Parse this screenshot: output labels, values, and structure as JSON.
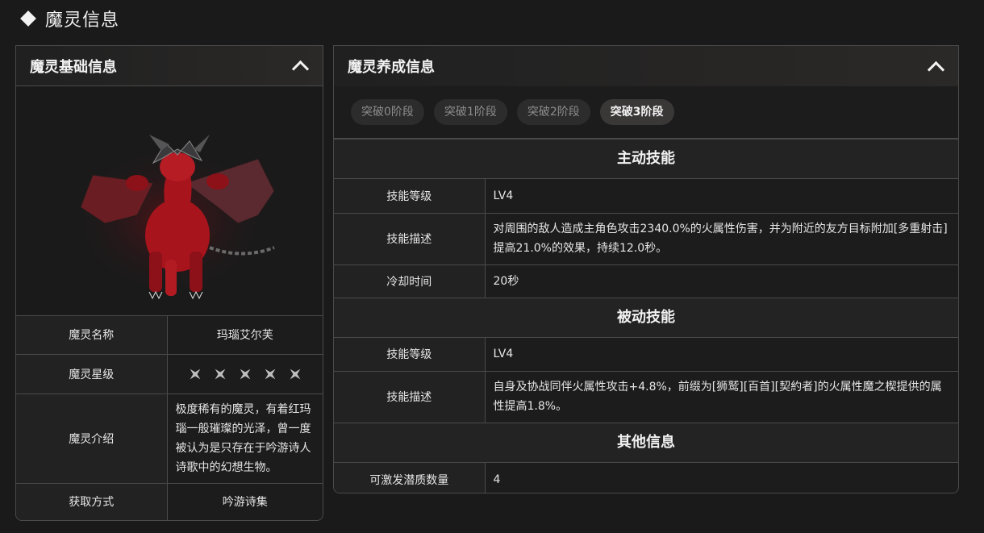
{
  "page": {
    "title": "魔灵信息"
  },
  "basic": {
    "title": "魔灵基础信息",
    "rows": {
      "name_label": "魔灵名称",
      "name_value": "玛瑙艾尔芙",
      "star_label": "魔灵星级",
      "star_count": 5,
      "intro_label": "魔灵介绍",
      "intro_value": "极度稀有的魔灵，有着红玛瑙一般璀璨的光泽，曾一度被认为是只存在于吟游诗人诗歌中的幻想生物。",
      "source_label": "获取方式",
      "source_value": "吟游诗集"
    }
  },
  "growth": {
    "title": "魔灵养成信息",
    "tabs": [
      "突破0阶段",
      "突破1阶段",
      "突破2阶段",
      "突破3阶段"
    ],
    "active_tab": 3,
    "active_skill": {
      "title": "主动技能",
      "level_label": "技能等级",
      "level_value": "LV4",
      "desc_label": "技能描述",
      "desc_value": "对周围的敌人造成主角色攻击2340.0%的火属性伤害，并为附近的友方目标附加[多重射击]提高21.0%的效果，持续12.0秒。",
      "cd_label": "冷却时间",
      "cd_value": "20秒"
    },
    "passive_skill": {
      "title": "被动技能",
      "level_label": "技能等级",
      "level_value": "LV4",
      "desc_label": "技能描述",
      "desc_value": "自身及协战同伴火属性攻击+4.8%，前缀为[狮鹫][百首][契約者]的火属性魔之楔提供的属性提高1.8%。"
    },
    "other": {
      "title": "其他信息",
      "potential_label": "可激发潜质数量",
      "potential_value": "4"
    }
  },
  "colors": {
    "accent_red": "#a8141c",
    "panel_border": "#4a4a4a"
  }
}
